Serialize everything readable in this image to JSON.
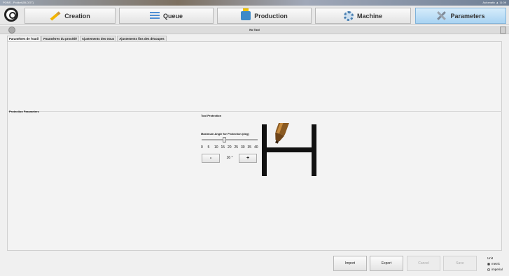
{
  "window": {
    "title": "PONS - Pokket [BLDG7]",
    "right_text": "Automatic ▲ 11:09"
  },
  "nav": {
    "creation": "Creation",
    "queue": "Queue",
    "production": "Production",
    "machine": "Machine",
    "parameters": "Parameters"
  },
  "subbar": {
    "title": "No Tool"
  },
  "tabs": [
    "Paramètres de l'outil",
    "Paramètres du procédé",
    "Ajustements des trous",
    "Ajustements fins des découpes"
  ],
  "sections": {
    "protection_parameters": "Protection Parameters",
    "tool_protection": "Tool Protection",
    "max_angle_label": "Maximum Angle for Protection (deg)"
  },
  "slider": {
    "ticks": [
      "0",
      "5",
      "10",
      "15",
      "20",
      "25",
      "30",
      "35",
      "40"
    ],
    "value_fraction": 0.4
  },
  "stepper": {
    "minus": "-",
    "value": "16 °",
    "plus": "+"
  },
  "buttons": {
    "import": "Import",
    "export": "Export",
    "cancel": "Cancel",
    "save": "Save"
  },
  "unit": {
    "label": "Unit",
    "metric": "metric",
    "imperial": "imperial",
    "selected": "metric"
  }
}
